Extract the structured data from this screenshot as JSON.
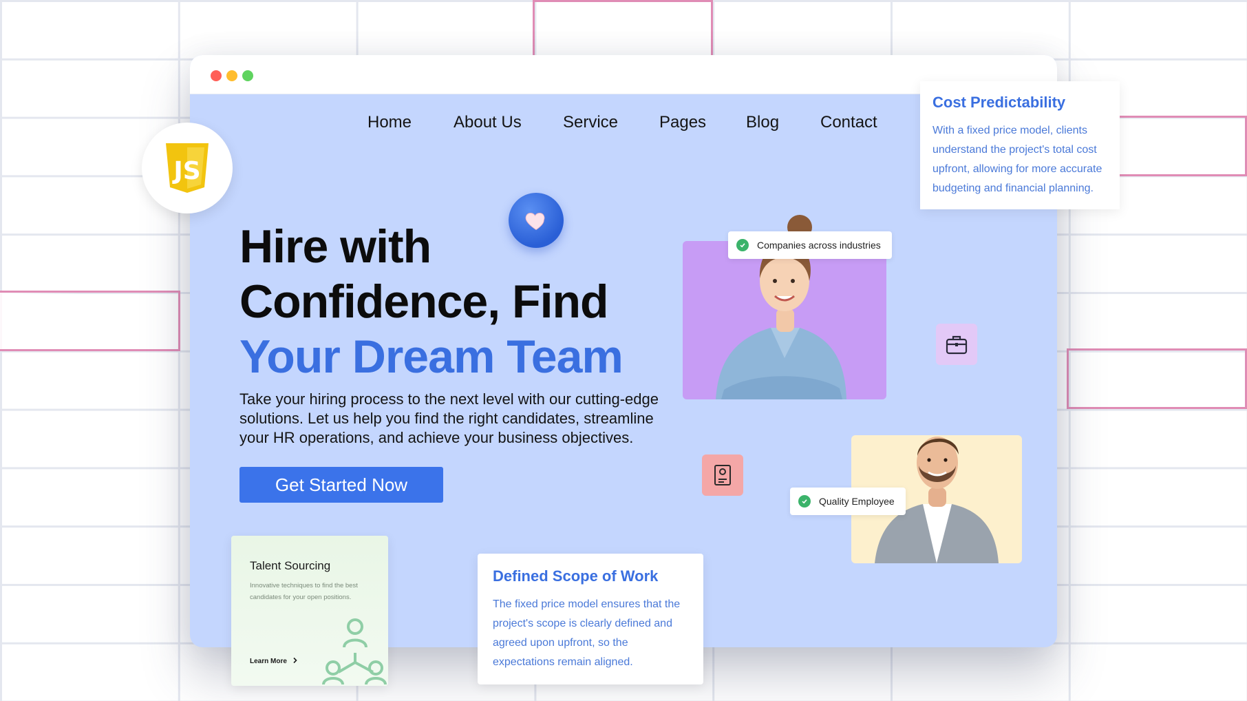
{
  "window": {
    "controls": [
      "close",
      "minimize",
      "maximize"
    ]
  },
  "nav": {
    "items": [
      {
        "label": "Home"
      },
      {
        "label": "About Us"
      },
      {
        "label": "Service"
      },
      {
        "label": "Pages"
      },
      {
        "label": "Blog"
      },
      {
        "label": "Contact"
      }
    ]
  },
  "hero": {
    "title_line1": "Hire with",
    "title_line2": "Confidence, Find",
    "title_accent": "Your Dream Team",
    "description": "Take your hiring process to the next level with our cutting-edge solutions. Let us help you find the right candidates, streamline your HR operations, and achieve your business objectives.",
    "cta_label": "Get Started Now"
  },
  "badges": {
    "companies": "Companies across industries",
    "quality": "Quality Employee"
  },
  "cards": {
    "cost": {
      "title": "Cost Predictability",
      "body": "With a fixed price model, clients understand the project's total cost upfront, allowing for more accurate budgeting and financial planning."
    },
    "scope": {
      "title": "Defined Scope of Work",
      "body": "The fixed price model ensures that the project's scope is clearly defined and agreed upon upfront, so the expectations remain aligned."
    },
    "talent": {
      "title": "Talent Sourcing",
      "body": "Innovative techniques to find the best candidates for your open positions.",
      "link": "Learn More"
    }
  },
  "logo": {
    "text": "JS"
  },
  "colors": {
    "page_bg": "#c4d6fe",
    "accent": "#3a6fe0",
    "cta": "#3b73ea",
    "woman_bg": "#c79cf5",
    "man_bg": "#fdf0cd",
    "check": "#3bb36a"
  },
  "icons": [
    "heart-icon",
    "briefcase-icon",
    "document-icon",
    "check-icon",
    "js-logo-icon",
    "team-network-icon",
    "chevron-right-icon"
  ]
}
